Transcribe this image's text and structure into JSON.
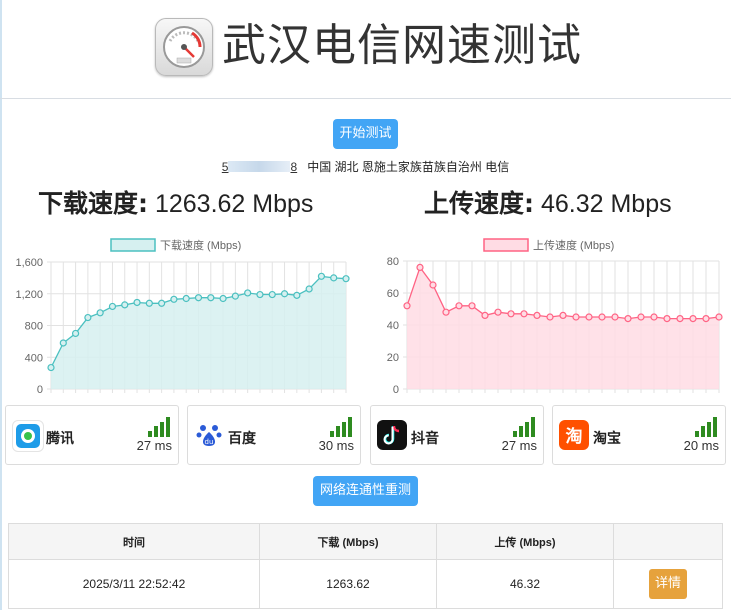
{
  "header": {
    "title": "武汉电信网速测试",
    "logo_icon": "speedometer-icon"
  },
  "start_button": {
    "label": "开始测试"
  },
  "info": {
    "ip_left": "5",
    "ip_right": "8",
    "location": "中国 湖北 恩施土家族苗族自治州 电信"
  },
  "download": {
    "label": "下载速度:",
    "value": "1263.62 Mbps"
  },
  "upload": {
    "label": "上传速度:",
    "value": "46.32 Mbps"
  },
  "chart_data": [
    {
      "type": "area",
      "series": [
        {
          "name": "下载速度 (Mbps)",
          "values": [
            270,
            580,
            700,
            900,
            960,
            1040,
            1060,
            1090,
            1080,
            1080,
            1130,
            1140,
            1150,
            1150,
            1140,
            1170,
            1210,
            1190,
            1190,
            1200,
            1180,
            1260,
            1420,
            1400,
            1390
          ]
        }
      ],
      "ylim": [
        0,
        1600
      ],
      "yticks": [
        "0",
        "400",
        "800",
        "1,200",
        "1,600"
      ],
      "grid": true,
      "legend": "top",
      "color": "#4bc0c0",
      "fill": "#d6f0f0"
    },
    {
      "type": "area",
      "series": [
        {
          "name": "上传速度 (Mbps)",
          "values": [
            52,
            76,
            65,
            48,
            52,
            52,
            46,
            48,
            47,
            47,
            46,
            45,
            46,
            45,
            45,
            45,
            45,
            44,
            45,
            45,
            44,
            44,
            44,
            44,
            45
          ]
        }
      ],
      "ylim": [
        0,
        80
      ],
      "yticks": [
        "0",
        "20",
        "40",
        "60",
        "80"
      ],
      "grid": true,
      "legend": "top",
      "color": "#ff6384",
      "fill": "#ffdce4"
    }
  ],
  "sites": [
    {
      "name": "腾讯",
      "latency": "27 ms",
      "icon": "tencent-icon",
      "color": "#1e9ce8"
    },
    {
      "name": "百度",
      "latency": "30 ms",
      "icon": "baidu-icon",
      "color": "#2b5bd7"
    },
    {
      "name": "抖音",
      "latency": "27 ms",
      "icon": "douyin-icon",
      "color": "#111111"
    },
    {
      "name": "淘宝",
      "latency": "20 ms",
      "icon": "taobao-icon",
      "color": "#ff5000"
    }
  ],
  "retest_button": {
    "label": "网络连通性重测"
  },
  "table": {
    "headers": [
      "时间",
      "下载 (Mbps)",
      "上传 (Mbps)",
      ""
    ],
    "rows": [
      {
        "time": "2025/3/11 22:52:42",
        "download": "1263.62",
        "upload": "46.32",
        "action": "详情"
      }
    ]
  }
}
